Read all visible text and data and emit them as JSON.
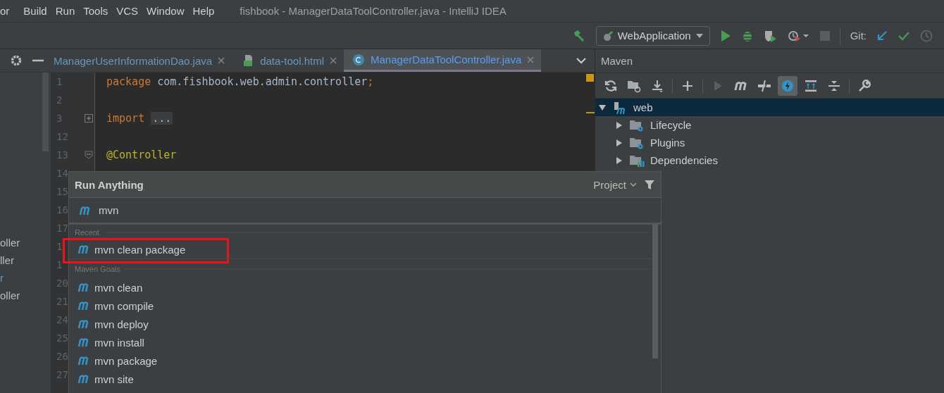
{
  "menu": [
    "or",
    "Build",
    "Run",
    "Tools",
    "VCS",
    "Window",
    "Help"
  ],
  "window_title": "fishbook - ManagerDataToolController.java - IntelliJ IDEA",
  "run_config": "WebApplication",
  "git_label": "Git:",
  "project_fragments": [
    {
      "text": "oller",
      "color": "#bbbbbb"
    },
    {
      "text": "ller",
      "color": "#bbbbbb"
    },
    {
      "text": "r",
      "color": "#6897bb"
    },
    {
      "text": "oller",
      "color": "#bbbbbb"
    }
  ],
  "editor_tabs": [
    {
      "label": "ManagerUserInformationDao.java",
      "kind": "java-interface",
      "selected": false
    },
    {
      "label": "data-tool.html",
      "kind": "html",
      "selected": false
    },
    {
      "label": "ManagerDataToolController.java",
      "kind": "java-class",
      "selected": true
    }
  ],
  "lines": [
    {
      "number": "1",
      "tokens": [
        {
          "kind": "keyword",
          "text": "package"
        },
        {
          "kind": "plain",
          "text": " com.fishbook.web.admin.controller"
        },
        {
          "kind": "keyword",
          "text": ";"
        }
      ]
    },
    {
      "number": "2"
    },
    {
      "number": "3",
      "folded": true,
      "tokens": [
        {
          "kind": "keyword",
          "text": "import"
        },
        {
          "kind": "folded",
          "text": "..."
        }
      ]
    },
    {
      "number": "12"
    },
    {
      "number": "13",
      "folded": false,
      "tokens": [
        {
          "kind": "annotation",
          "text": "@Controller"
        }
      ]
    },
    {
      "number": "14"
    },
    {
      "number": "15"
    },
    {
      "number": "16"
    },
    {
      "number": "17"
    },
    {
      "number": "1"
    },
    {
      "number": "1"
    },
    {
      "number": "20"
    },
    {
      "number": "21"
    },
    {
      "number": "24"
    },
    {
      "number": "25"
    },
    {
      "number": "26"
    },
    {
      "number": "27"
    }
  ],
  "maven": {
    "title": "Maven",
    "toolbar_groups": [
      {
        "buttons": [
          {
            "kind": "refresh",
            "on": false
          },
          {
            "kind": "folder-refresh",
            "on": false
          },
          {
            "kind": "download",
            "on": false
          }
        ]
      },
      {
        "buttons": [
          {
            "kind": "plus",
            "on": false
          }
        ]
      },
      {
        "buttons": [
          {
            "kind": "run",
            "on": false
          },
          {
            "kind": "maven",
            "on": false
          },
          {
            "kind": "skip-tests",
            "on": false
          },
          {
            "kind": "lightning",
            "on": true
          },
          {
            "kind": "expand",
            "on": false
          },
          {
            "kind": "collapse",
            "on": false
          }
        ]
      },
      {
        "buttons": [
          {
            "kind": "wrench",
            "on": false
          }
        ]
      }
    ],
    "tree": [
      {
        "label": "web",
        "kind": "project",
        "selected": true,
        "expanded": true,
        "children": [
          {
            "label": "Lifecycle",
            "kind": "gear-folder",
            "selected": false,
            "expanded": false
          },
          {
            "label": "Plugins",
            "kind": "gear-folder",
            "selected": false,
            "expanded": false
          },
          {
            "label": "Dependencies",
            "kind": "chart-folder",
            "selected": false,
            "expanded": false
          }
        ]
      }
    ]
  },
  "run_anything": {
    "title": "Run Anything",
    "scope": "Project",
    "query": "mvn",
    "sections": [
      {
        "title": "Recent",
        "items": [
          {
            "label": "mvn clean package",
            "highlighted": true
          }
        ]
      },
      {
        "title": "Maven Goals",
        "items": [
          {
            "label": "mvn clean",
            "highlighted": false
          },
          {
            "label": "mvn compile",
            "highlighted": false
          },
          {
            "label": "mvn deploy",
            "highlighted": false
          },
          {
            "label": "mvn install",
            "highlighted": false
          },
          {
            "label": "mvn package",
            "highlighted": false
          },
          {
            "label": "mvn site",
            "highlighted": false
          }
        ]
      }
    ]
  }
}
